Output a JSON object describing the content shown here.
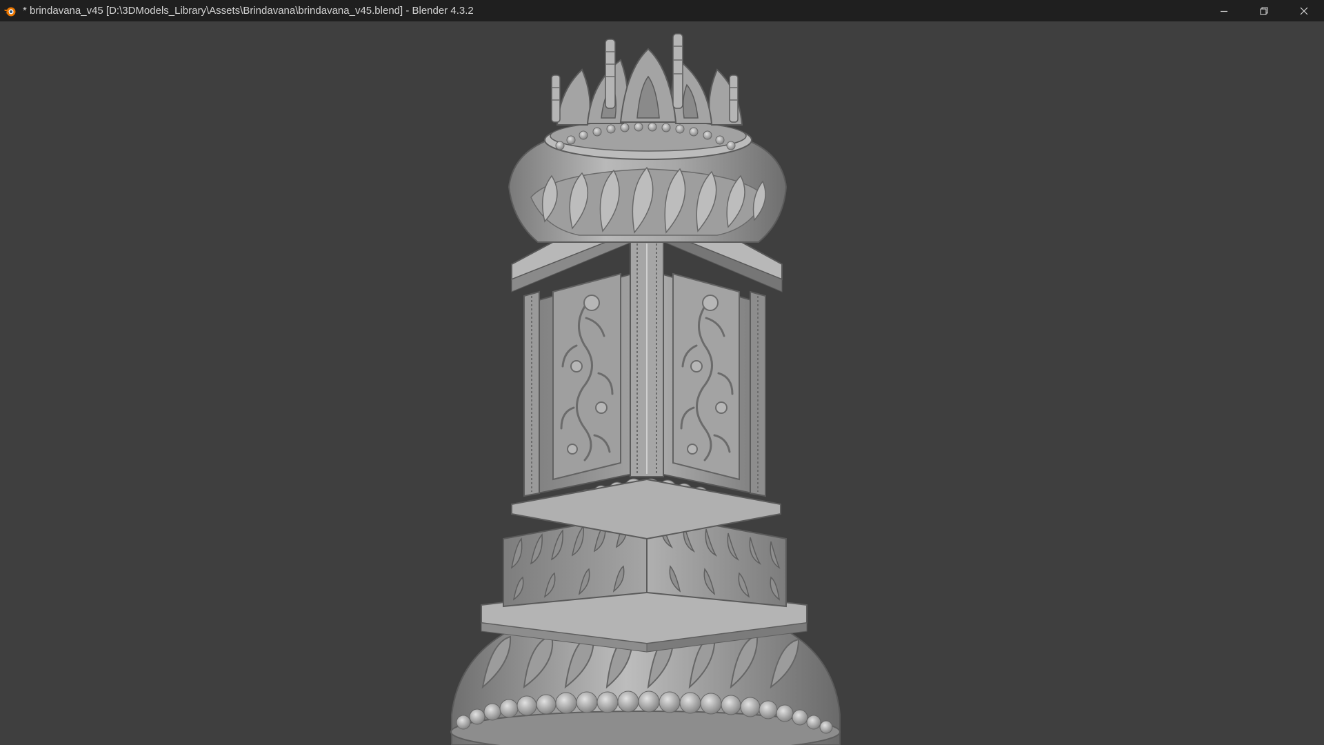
{
  "window": {
    "title": "* brindavana_v45 [D:\\3DModels_Library\\Assets\\Brindavana\\brindavana_v45.blend] - Blender 4.3.2",
    "app_icon": "blender-logo-icon",
    "controls": {
      "minimize_icon": "minimize-icon",
      "restore_icon": "restore-icon",
      "close_icon": "close-icon"
    }
  },
  "viewport": {
    "background_color": "#3f3f3f",
    "model_color": "#a9a9a9",
    "object": "brindavana-model"
  },
  "colors": {
    "titlebar_bg": "#1f1f1f",
    "titlebar_text": "#d4d4d4",
    "blender_orange": "#ea7600"
  }
}
